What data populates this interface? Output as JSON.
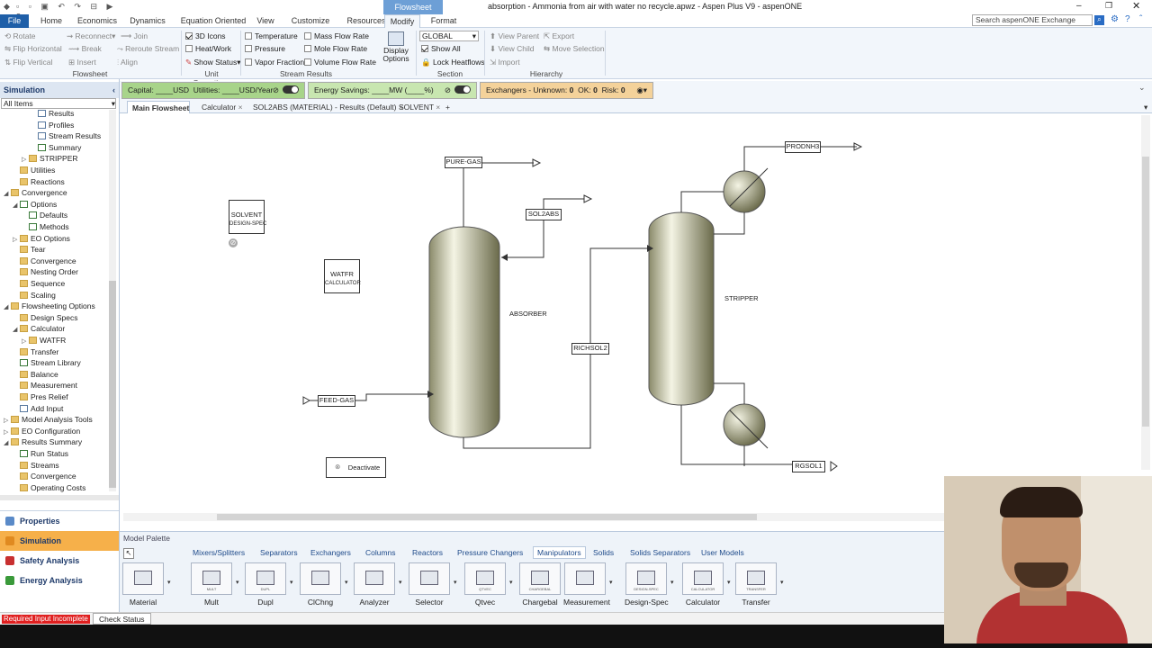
{
  "window": {
    "title": "absorption - Ammonia from air with water no recycle.apwz - Aspen Plus V9 - aspenONE",
    "context_tab": "Flowsheet",
    "search_placeholder": "Search aspenONE Exchange"
  },
  "menu": {
    "file": "File",
    "tabs": [
      "Home",
      "Economics",
      "Dynamics",
      "Equation Oriented",
      "View",
      "Customize",
      "Resources",
      "Modify",
      "Format"
    ]
  },
  "ribbon": {
    "flowsheet_group": {
      "rotate": "Rotate",
      "flip_h": "Flip Horizontal",
      "flip_v": "Flip Vertical",
      "reconnect": "Reconnect",
      "join": "Join",
      "break": "Break",
      "reroute": "Reroute Stream",
      "insert": "Insert",
      "align": "Align",
      "label": "Flowsheet"
    },
    "unit_ops_group": {
      "icons3d": "3D Icons",
      "heatwork": "Heat/Work",
      "show_status": "Show Status",
      "label": "Unit Operations"
    },
    "stream_results_group": {
      "temperature": "Temperature",
      "pressure": "Pressure",
      "vapor_fraction": "Vapor Fraction",
      "mass_flow": "Mass Flow Rate",
      "mole_flow": "Mole Flow Rate",
      "volume_flow": "Volume Flow Rate",
      "label": "Stream Results"
    },
    "display_options": "Display Options",
    "section_group": {
      "select_value": "GLOBAL",
      "show_all": "Show All",
      "lock_heatflows": "Lock Heatflows",
      "label": "Section"
    },
    "hierarchy_group": {
      "view_parent": "View Parent",
      "view_child": "View Child",
      "import": "Import",
      "export": "Export",
      "move_selection": "Move Selection",
      "label": "Hierarchy"
    }
  },
  "left_panel": {
    "header": "Simulation",
    "filter": "All Items",
    "tree": [
      {
        "label": "Results",
        "icon": "form",
        "indent": 3,
        "toggle": ""
      },
      {
        "label": "Profiles",
        "icon": "form",
        "indent": 3,
        "toggle": ""
      },
      {
        "label": "Stream Results",
        "icon": "form",
        "indent": 3,
        "toggle": ""
      },
      {
        "label": "Summary",
        "icon": "check",
        "indent": 3,
        "toggle": ""
      },
      {
        "label": "STRIPPER",
        "icon": "folder",
        "indent": 2,
        "toggle": "▷"
      },
      {
        "label": "Utilities",
        "icon": "folder",
        "indent": 1,
        "toggle": ""
      },
      {
        "label": "Reactions",
        "icon": "folder",
        "indent": 1,
        "toggle": ""
      },
      {
        "label": "Convergence",
        "icon": "folder",
        "indent": 0,
        "toggle": "◢"
      },
      {
        "label": "Options",
        "icon": "check",
        "indent": 1,
        "toggle": "◢"
      },
      {
        "label": "Defaults",
        "icon": "check",
        "indent": 2,
        "toggle": ""
      },
      {
        "label": "Methods",
        "icon": "check",
        "indent": 2,
        "toggle": ""
      },
      {
        "label": "EO Options",
        "icon": "folder",
        "indent": 1,
        "toggle": "▷"
      },
      {
        "label": "Tear",
        "icon": "folder",
        "indent": 1,
        "toggle": ""
      },
      {
        "label": "Convergence",
        "icon": "folder",
        "indent": 1,
        "toggle": ""
      },
      {
        "label": "Nesting Order",
        "icon": "folder",
        "indent": 1,
        "toggle": ""
      },
      {
        "label": "Sequence",
        "icon": "folder",
        "indent": 1,
        "toggle": ""
      },
      {
        "label": "Scaling",
        "icon": "folder",
        "indent": 1,
        "toggle": ""
      },
      {
        "label": "Flowsheeting Options",
        "icon": "folder",
        "indent": 0,
        "toggle": "◢"
      },
      {
        "label": "Design Specs",
        "icon": "folder",
        "indent": 1,
        "toggle": ""
      },
      {
        "label": "Calculator",
        "icon": "folder",
        "indent": 1,
        "toggle": "◢"
      },
      {
        "label": "WATFR",
        "icon": "folder",
        "indent": 2,
        "toggle": "▷"
      },
      {
        "label": "Transfer",
        "icon": "folder",
        "indent": 1,
        "toggle": ""
      },
      {
        "label": "Stream Library",
        "icon": "check",
        "indent": 1,
        "toggle": ""
      },
      {
        "label": "Balance",
        "icon": "folder",
        "indent": 1,
        "toggle": ""
      },
      {
        "label": "Measurement",
        "icon": "folder",
        "indent": 1,
        "toggle": ""
      },
      {
        "label": "Pres Relief",
        "icon": "folder",
        "indent": 1,
        "toggle": ""
      },
      {
        "label": "Add Input",
        "icon": "form",
        "indent": 1,
        "toggle": ""
      },
      {
        "label": "Model Analysis Tools",
        "icon": "folder",
        "indent": 0,
        "toggle": "▷"
      },
      {
        "label": "EO Configuration",
        "icon": "folder",
        "indent": 0,
        "toggle": "▷"
      },
      {
        "label": "Results Summary",
        "icon": "folder",
        "indent": 0,
        "toggle": "◢"
      },
      {
        "label": "Run Status",
        "icon": "check",
        "indent": 1,
        "toggle": ""
      },
      {
        "label": "Streams",
        "icon": "folder",
        "indent": 1,
        "toggle": ""
      },
      {
        "label": "Convergence",
        "icon": "folder",
        "indent": 1,
        "toggle": ""
      },
      {
        "label": "Operating Costs",
        "icon": "folder",
        "indent": 1,
        "toggle": ""
      }
    ],
    "nav": [
      "Properties",
      "Simulation",
      "Safety Analysis",
      "Energy Analysis"
    ]
  },
  "econ_bar": {
    "capital": "Capital: ____USD",
    "utilities": "Utilities: ____USD/Year",
    "energy": "Energy Savings: ____MW   (____%)",
    "exchangers": "Exchangers -   Unknown:",
    "unknown": "0",
    "ok_label": "OK:",
    "ok": "0",
    "risk_label": "Risk:",
    "risk": "0"
  },
  "doc_tabs": [
    "Main Flowsheet",
    "Calculator",
    "SOL2ABS (MATERIAL) - Results (Default)",
    "SOLVENT"
  ],
  "flowsheet": {
    "blocks": {
      "absorber": "ABSORBER",
      "stripper": "STRIPPER"
    },
    "streams": {
      "pure_gas": "PURE-GAS",
      "sol2abs": "SOL2ABS",
      "feed_gas": "FEED-GAS",
      "richsol2": "RICHSOL2",
      "prodnh3": "PRODNH3",
      "rgsol1": "RGSOL1"
    },
    "solvent": {
      "name": "SOLVENT",
      "type": "DESIGN-SPEC"
    },
    "watfr": {
      "name": "WATFR",
      "type": "CALCULATOR"
    },
    "deactivate": "Deactivate"
  },
  "palette": {
    "title": "Model Palette",
    "tabs": [
      "Mixers/Splitters",
      "Separators",
      "Exchangers",
      "Columns",
      "Reactors",
      "Pressure Changers",
      "Manipulators",
      "Solids",
      "Solids Separators",
      "User Models"
    ],
    "active_tab": "Manipulators",
    "items": [
      {
        "label": "Material",
        "icon_text": ""
      },
      {
        "label": "Mult",
        "icon_text": "MULT"
      },
      {
        "label": "Dupl",
        "icon_text": "DUPL"
      },
      {
        "label": "ClChng",
        "icon_text": ""
      },
      {
        "label": "Analyzer",
        "icon_text": ""
      },
      {
        "label": "Selector",
        "icon_text": ""
      },
      {
        "label": "Qtvec",
        "icon_text": "QTVEC"
      },
      {
        "label": "Chargebal",
        "icon_text": "CHARGEBAL"
      },
      {
        "label": "Measurement",
        "icon_text": ""
      },
      {
        "label": "Design-Spec",
        "icon_text": "DESIGN-SPEC"
      },
      {
        "label": "Calculator",
        "icon_text": "CALCULATOR"
      },
      {
        "label": "Transfer",
        "icon_text": "TRANSFER"
      }
    ]
  },
  "status": {
    "error": "Required Input Incomplete",
    "check": "Check Status"
  }
}
